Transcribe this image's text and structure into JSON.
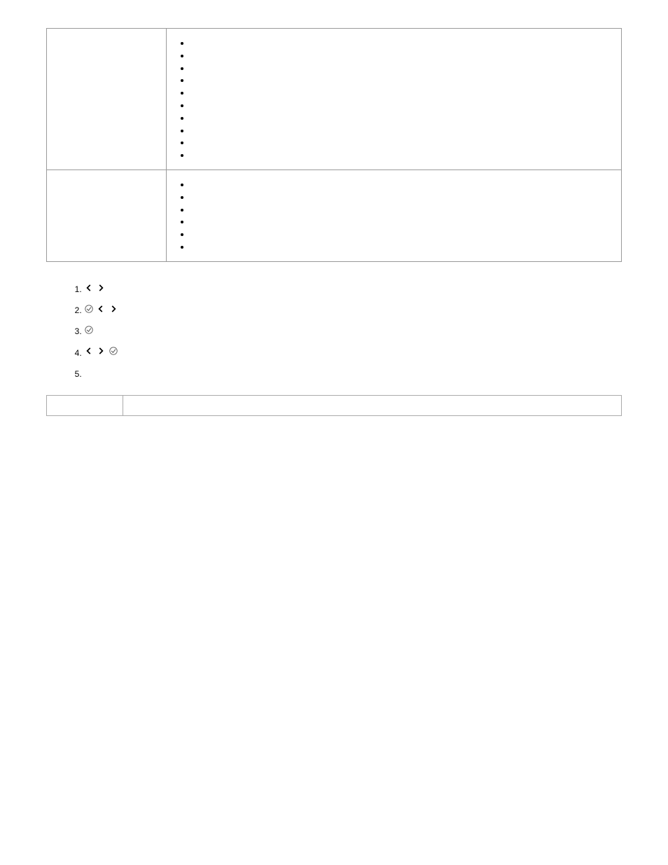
{
  "table1": {
    "row1_left": "",
    "row1_intro": "",
    "row1_items": [
      "",
      "",
      "",
      "",
      "",
      "",
      "",
      "",
      "",
      ""
    ],
    "row1_trail_prefix": "",
    "row1_link": "",
    "row2_left": "",
    "row2_intro": "",
    "row2_items": [
      "",
      "",
      "",
      "",
      "",
      ""
    ],
    "row2_trail_prefix": "",
    "row2_link": ""
  },
  "section_title": "",
  "para1": "",
  "steps": {
    "s1_a": "",
    "s1_b": "",
    "s2_a": "",
    "s2_b": "",
    "s2_c": "",
    "s3_a": "",
    "s3_b": "",
    "s4_a": "",
    "s4_b": "",
    "s4_c": "",
    "s5_a": "",
    "s5_b": ""
  },
  "note_label": "",
  "note_text": ""
}
